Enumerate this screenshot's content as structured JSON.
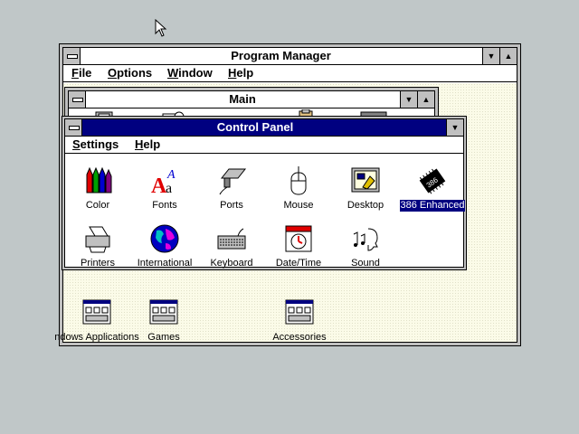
{
  "program_manager": {
    "title": "Program Manager",
    "menu": [
      "File",
      "Options",
      "Window",
      "Help"
    ],
    "menu_underline": [
      "F",
      "O",
      "W",
      "H"
    ],
    "menu_rest": [
      "ile",
      "ptions",
      "indow",
      "elp"
    ]
  },
  "main_window": {
    "title": "Main"
  },
  "control_panel": {
    "title": "Control Panel",
    "menu": [
      "Settings",
      "Help"
    ],
    "menu_underline": [
      "S",
      "H"
    ],
    "menu_rest": [
      "ettings",
      "elp"
    ],
    "icons": [
      {
        "label": "Color",
        "icon": "color-icon"
      },
      {
        "label": "Fonts",
        "icon": "fonts-icon"
      },
      {
        "label": "Ports",
        "icon": "ports-icon"
      },
      {
        "label": "Mouse",
        "icon": "mouse-icon"
      },
      {
        "label": "Desktop",
        "icon": "desktop-icon"
      },
      {
        "label": "386 Enhanced",
        "icon": "chip-icon",
        "selected": true
      },
      {
        "label": "Printers",
        "icon": "printer-icon"
      },
      {
        "label": "International",
        "icon": "globe-icon"
      },
      {
        "label": "Keyboard",
        "icon": "keyboard-icon"
      },
      {
        "label": "Date/Time",
        "icon": "calendar-clock-icon"
      },
      {
        "label": "Sound",
        "icon": "sound-icon"
      }
    ]
  },
  "program_groups": [
    {
      "label": "ndows Applications"
    },
    {
      "label": "Games"
    },
    {
      "label": "Accessories"
    }
  ],
  "colors": {
    "active_title": "#000080",
    "desktop": "#c0c7c8",
    "workspace": "#fbfbe8"
  }
}
